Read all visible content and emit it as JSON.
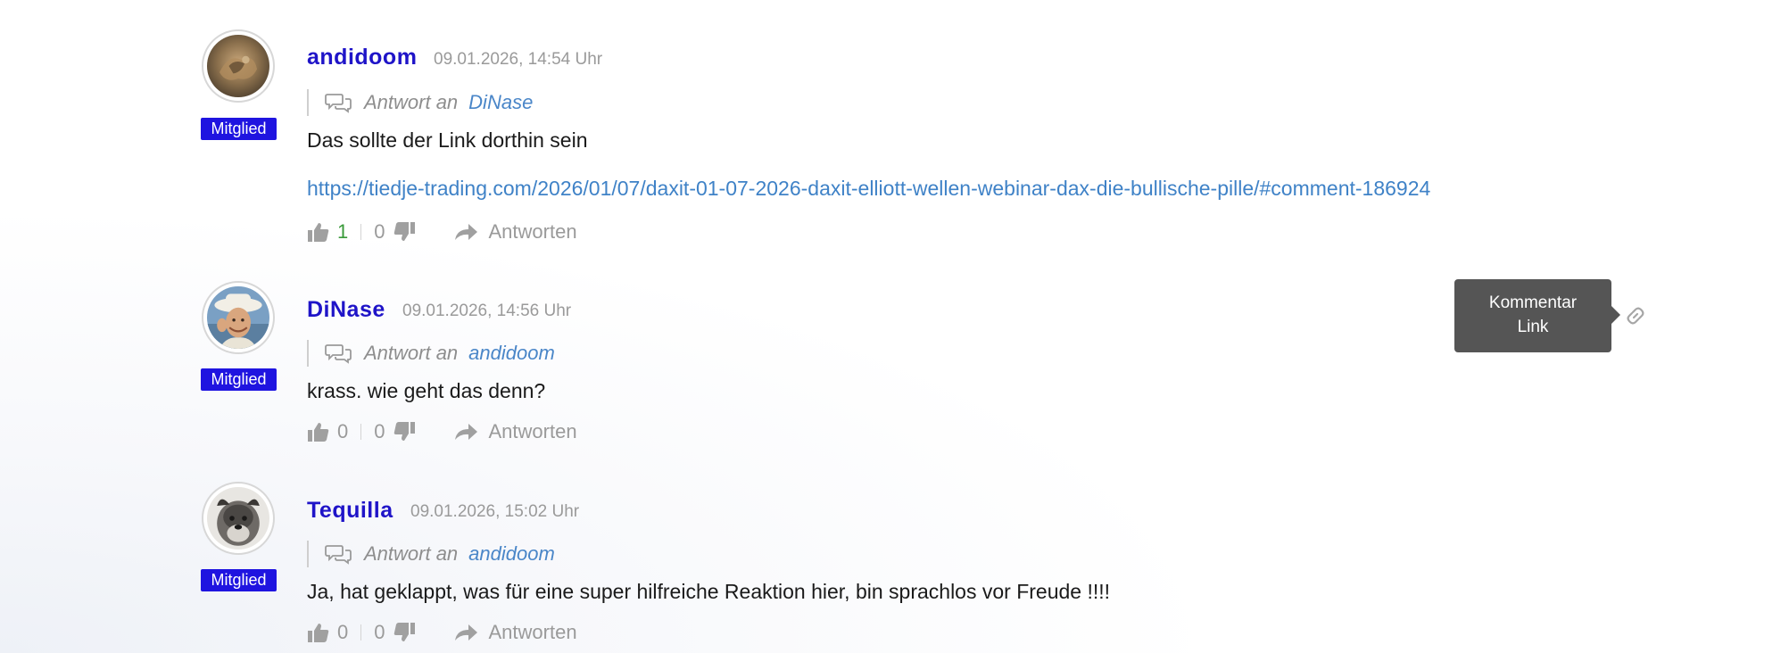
{
  "comments": [
    {
      "author": "andidoom",
      "timestamp": "09.01.2026, 14:54 Uhr",
      "role": "Mitglied",
      "reply_prefix": "Antwort an",
      "reply_to": "DiNase",
      "text": "Das sollte der Link dorthin sein",
      "link": "https://tiedje-trading.com/2026/01/07/daxit-01-07-2026-daxit-elliott-wellen-webinar-dax-die-bullische-pille/#comment-186924",
      "upvotes": "1",
      "downvotes": "0",
      "reply_label": "Antworten"
    },
    {
      "author": "DiNase",
      "timestamp": "09.01.2026, 14:56 Uhr",
      "role": "Mitglied",
      "reply_prefix": "Antwort an",
      "reply_to": "andidoom",
      "text": "krass. wie geht das denn?",
      "upvotes": "0",
      "downvotes": "0",
      "reply_label": "Antworten"
    },
    {
      "author": "Tequilla",
      "timestamp": "09.01.2026, 15:02 Uhr",
      "role": "Mitglied",
      "reply_prefix": "Antwort an",
      "reply_to": "andidoom",
      "text": "Ja, hat geklappt, was für eine super hilfreiche Reaktion hier, bin sprachlos vor Freude !!!!",
      "upvotes": "0",
      "downvotes": "0",
      "reply_label": "Antworten"
    }
  ],
  "tooltip": {
    "line1": "Kommentar",
    "line2": "Link"
  },
  "icons": {
    "reply_context": "speech-bubbles-icon",
    "upvote": "thumbs-up-icon",
    "downvote": "thumbs-down-icon",
    "reply": "share-arrow-icon",
    "permalink": "chain-link-icon"
  },
  "colors": {
    "author": "#1f14c8",
    "badge": "#1f14e0",
    "link": "#3f82c7",
    "upvote_positive": "#3a9a3a",
    "muted": "#9a9a9a",
    "tooltip_bg": "#555555"
  }
}
